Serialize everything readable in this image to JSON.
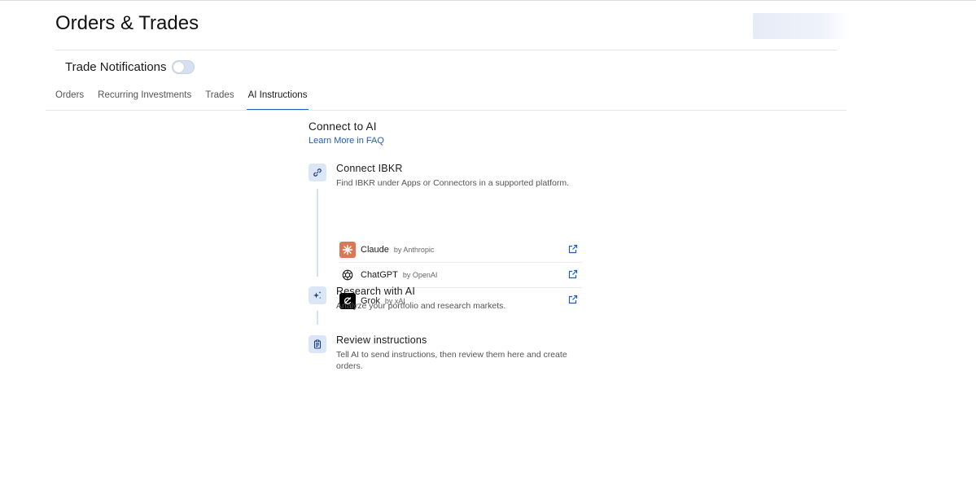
{
  "page": {
    "title": "Orders & Trades"
  },
  "notifications": {
    "label": "Trade Notifications",
    "enabled": false
  },
  "tabs": [
    {
      "label": "Orders"
    },
    {
      "label": "Recurring Investments"
    },
    {
      "label": "Trades"
    },
    {
      "label": "AI Instructions",
      "active": true
    }
  ],
  "connect": {
    "title": "Connect to AI",
    "faq_link": "Learn More in FAQ"
  },
  "steps": [
    {
      "icon": "link-icon",
      "title": "Connect IBKR",
      "desc": "Find IBKR under Apps or Connectors in a supported platform."
    },
    {
      "icon": "sparkles-icon",
      "title": "Research with AI",
      "desc": "Analyze your portfolio and research markets."
    },
    {
      "icon": "clipboard-icon",
      "title": "Review instructions",
      "desc": "Tell AI to send instructions, then review them here and create orders."
    }
  ],
  "platforms": [
    {
      "name": "Claude",
      "by": "by Anthropic",
      "logo": "claude-logo-icon",
      "logo_color": "#d97757"
    },
    {
      "name": "ChatGPT",
      "by": "by OpenAI",
      "logo": "openai-logo-icon",
      "logo_color": "#ffffff"
    },
    {
      "name": "Grok",
      "by": "by xAI",
      "logo": "grok-logo-icon",
      "logo_color": "#000000"
    }
  ],
  "colors": {
    "accent": "#1f5dbf",
    "icon_bg": "#dbe6f7",
    "timeline": "#d6e2f3"
  }
}
